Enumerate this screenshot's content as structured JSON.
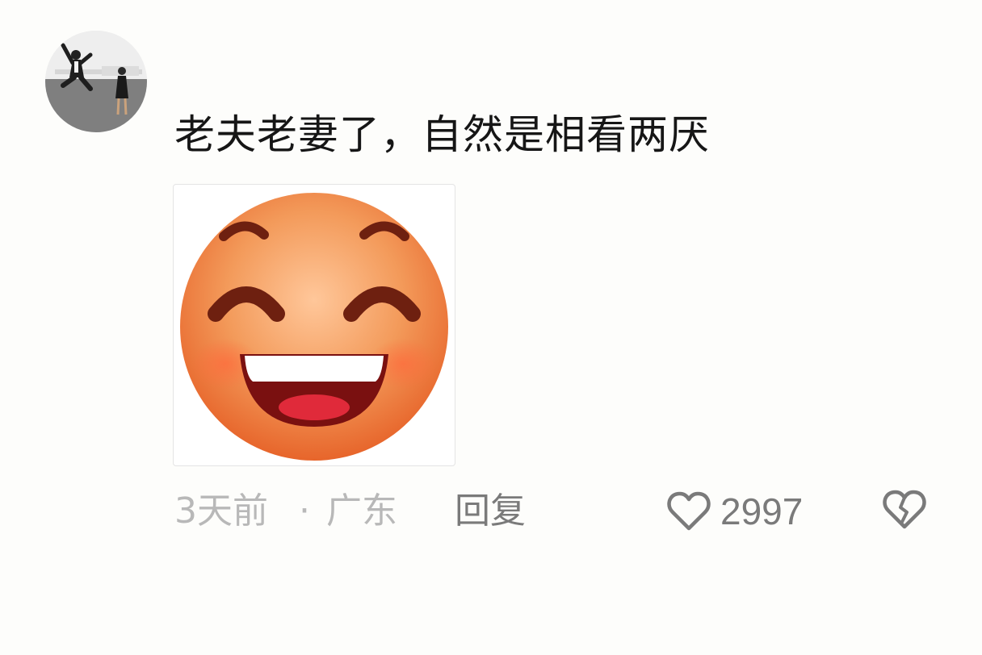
{
  "comment": {
    "avatar_icon": "couple-jumping-photo",
    "text": "老夫老妻了，自然是相看两厌",
    "sticker_icon": "grinning-emoji-sticker"
  },
  "meta": {
    "time": "3天前",
    "separator": "·",
    "location": "广东",
    "reply_label": "回复",
    "like_icon": "heart-outline-icon",
    "like_count": "2997",
    "dislike_icon": "broken-heart-icon"
  },
  "colors": {
    "text": "#161616",
    "meta": "#b8b8b8",
    "action": "#7a7a7a",
    "sticker_face": "#f07a3a"
  }
}
